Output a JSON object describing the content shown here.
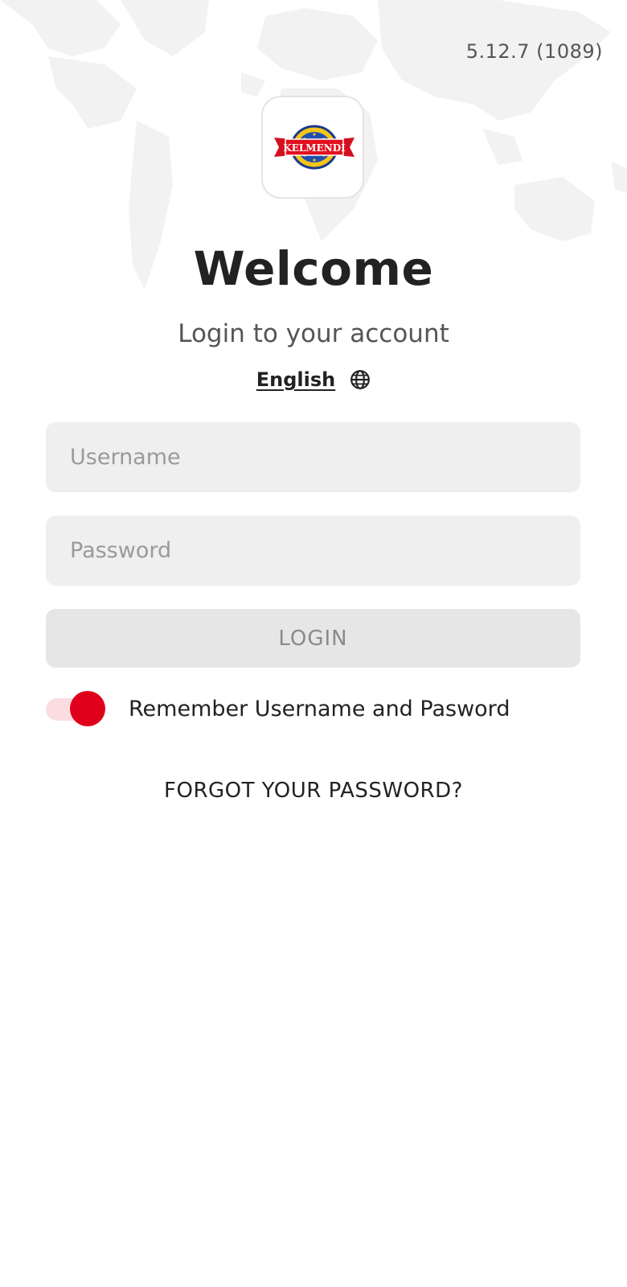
{
  "version": "5.12.7 (1089)",
  "logo": {
    "text": "KELMENDI"
  },
  "header": {
    "title": "Welcome",
    "subtitle": "Login to your account"
  },
  "language": {
    "label": "English",
    "icon": "globe-icon"
  },
  "form": {
    "username_placeholder": "Username",
    "password_placeholder": "Password",
    "login_label": "LOGIN",
    "remember_label": "Remember Username and Pasword",
    "remember_enabled": true,
    "forgot_label": "FORGOT YOUR PASSWORD?"
  },
  "colors": {
    "accent": "#e0001b",
    "field_bg": "#efefef",
    "button_disabled_bg": "#e6e6e6"
  }
}
